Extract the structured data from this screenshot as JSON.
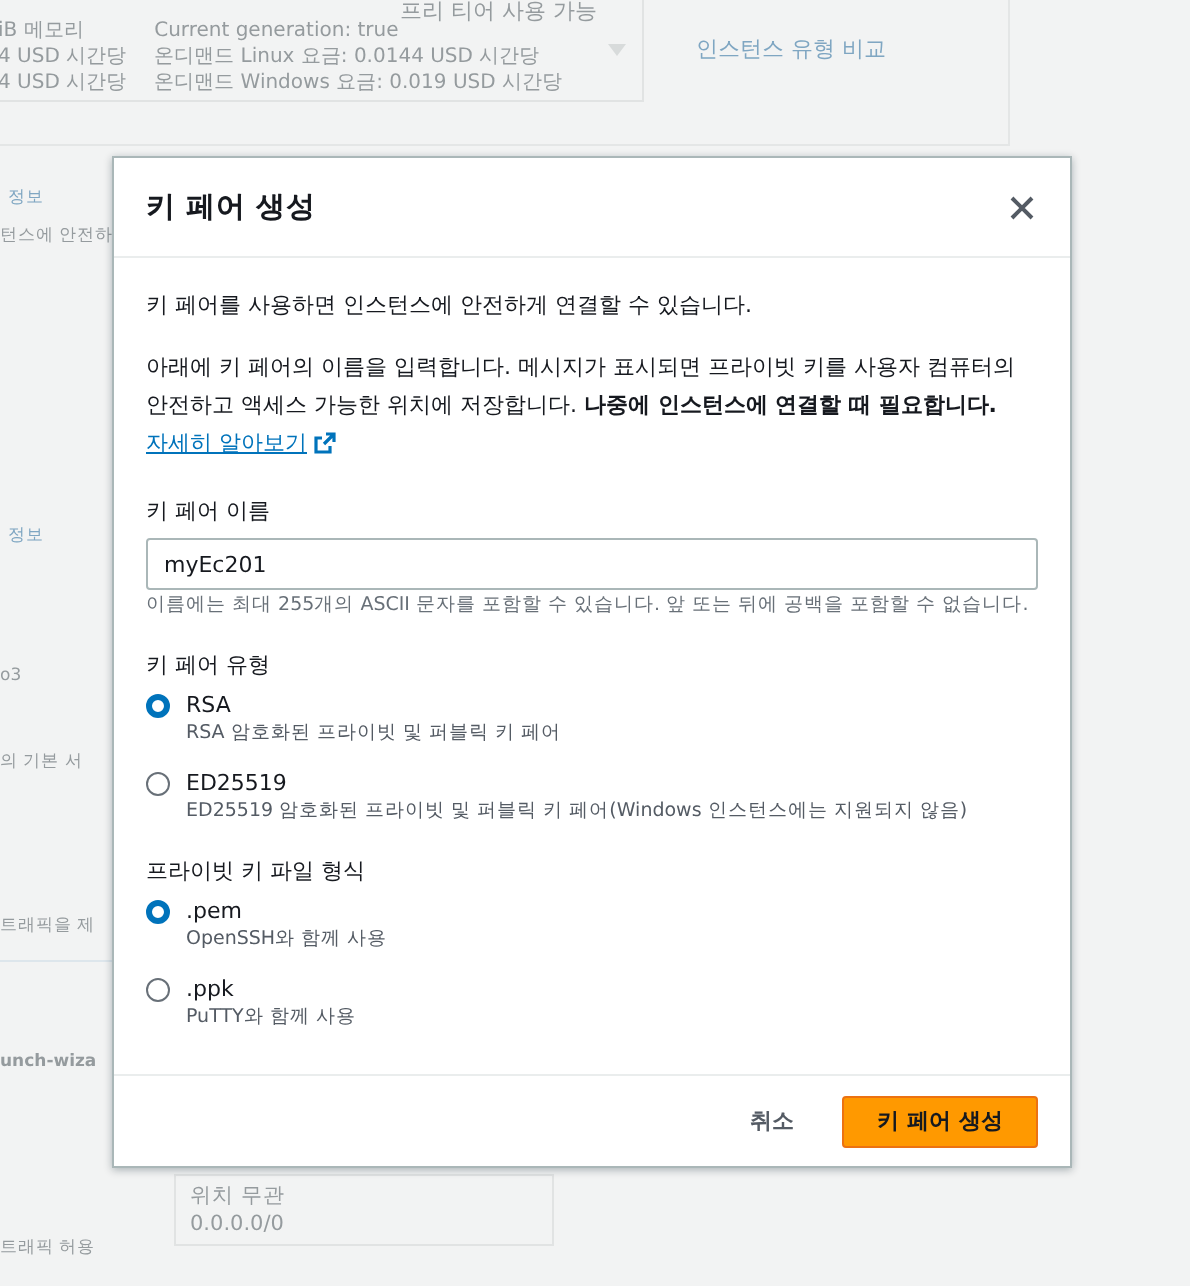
{
  "background": {
    "instance_card": {
      "badge": "프리 티어 사용 가능",
      "lines": [
        [
          "iB 메모리",
          "Current generation: true"
        ],
        [
          "4 USD 시간당",
          "온디맨드 Linux 요금: 0.0144 USD 시간당"
        ],
        [
          "4 USD 시간당",
          "온디맨드 Windows 요금: 0.019 USD 시간당"
        ]
      ]
    },
    "compare_link": "인스턴스 유형 비교",
    "left_fragments": [
      {
        "kind": "link",
        "text": "정보"
      },
      {
        "kind": "text",
        "text": "턴스에 안전하"
      },
      {
        "kind": "link",
        "text": "정보"
      },
      {
        "kind": "text",
        "text": "o3"
      },
      {
        "kind": "text",
        "text": "의 기본 서"
      },
      {
        "kind": "text",
        "text": "트래픽을 제"
      },
      {
        "kind": "bold",
        "text": "unch-wiza"
      },
      {
        "kind": "text",
        "text": "트래픽 허용"
      }
    ],
    "source_select": {
      "label": "위치 무관",
      "value": "0.0.0.0/0"
    }
  },
  "dialog": {
    "title": "키 페어 생성",
    "intro": "키 페어를 사용하면 인스턴스에 안전하게 연결할 수 있습니다.",
    "description": "아래에 키 페어의 이름을 입력합니다. 메시지가 표시되면 프라이빗 키를 사용자 컴퓨터의 안전하고 액세스 가능한 위치에 저장합니다. **나중에 인스턴스에 연결할 때 필요합니다.**",
    "learn_more": "자세히 알아보기",
    "name_field": {
      "label": "키 페어 이름",
      "value": "myEc201",
      "hint": "이름에는 최대 255개의 ASCII 문자를 포함할 수 있습니다. 앞 또는 뒤에 공백을 포함할 수 없습니다."
    },
    "groups": [
      {
        "label": "키 페어 유형",
        "options": [
          {
            "label": "RSA",
            "description": "RSA 암호화된 프라이빗 및 퍼블릭 키 페어",
            "selected": true
          },
          {
            "label": "ED25519",
            "description": "ED25519 암호화된 프라이빗 및 퍼블릭 키 페어(Windows 인스턴스에는 지원되지 않음)",
            "selected": false
          }
        ]
      },
      {
        "label": "프라이빗 키 파일 형식",
        "options": [
          {
            "label": ".pem",
            "description": "OpenSSH와 함께 사용",
            "selected": true
          },
          {
            "label": ".ppk",
            "description": "PuTTY와 함께 사용",
            "selected": false
          }
        ]
      }
    ],
    "buttons": [
      {
        "kind": "link",
        "label": "취소"
      },
      {
        "kind": "primary",
        "label": "키 페어 생성"
      }
    ]
  }
}
